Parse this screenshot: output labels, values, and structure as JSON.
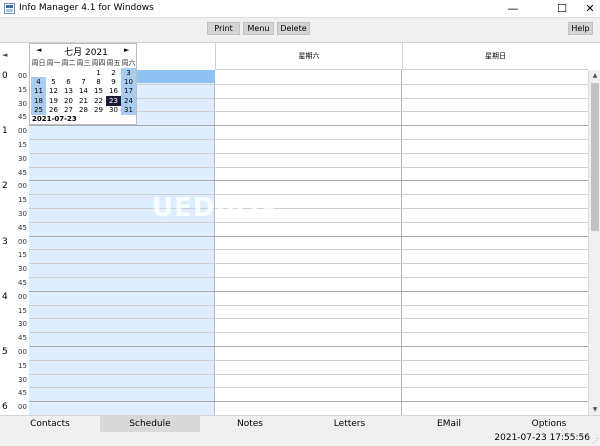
{
  "window": {
    "title": "Info Manager 4.1 for Windows",
    "min_glyph": "—",
    "max_glyph": "☐",
    "close_glyph": "✕"
  },
  "toolbar": {
    "print": "Print",
    "menu": "Menu",
    "delete": "Delete",
    "help": "Help"
  },
  "schedule": {
    "columns": [
      "星期六",
      "星期日"
    ],
    "nav_left": "◄",
    "hours": [
      "0",
      "1",
      "2",
      "3",
      "4",
      "5",
      "6"
    ],
    "minutes": [
      "00",
      "15",
      "30",
      "45"
    ]
  },
  "minical": {
    "title": "七月 2021",
    "prev": "◄",
    "next": "►",
    "weekdays": [
      "周日",
      "周一",
      "周二",
      "周三",
      "周四",
      "周五",
      "周六"
    ],
    "weeks": [
      [
        "",
        "",
        "",
        "",
        "1",
        "2",
        "3"
      ],
      [
        "4",
        "5",
        "6",
        "7",
        "8",
        "9",
        "10"
      ],
      [
        "11",
        "12",
        "13",
        "14",
        "15",
        "16",
        "17"
      ],
      [
        "18",
        "19",
        "20",
        "21",
        "22",
        "23",
        "24"
      ],
      [
        "25",
        "26",
        "27",
        "28",
        "29",
        "30",
        "31"
      ]
    ],
    "today": "23",
    "selected_date": "2021-07-23"
  },
  "tabs": {
    "contacts": "Contacts",
    "schedule": "Schedule",
    "notes": "Notes",
    "letters": "Letters",
    "email": "EMail",
    "options": "Options",
    "active": "schedule"
  },
  "status": {
    "datetime": "2021-07-23 17:55:56"
  },
  "watermark": "UEDBOX",
  "colors": {
    "day_column": "#dceeff",
    "selected_slot": "#8ec3f3",
    "weekend_day": "#a8cdf0",
    "today": "#1b1b3a"
  }
}
